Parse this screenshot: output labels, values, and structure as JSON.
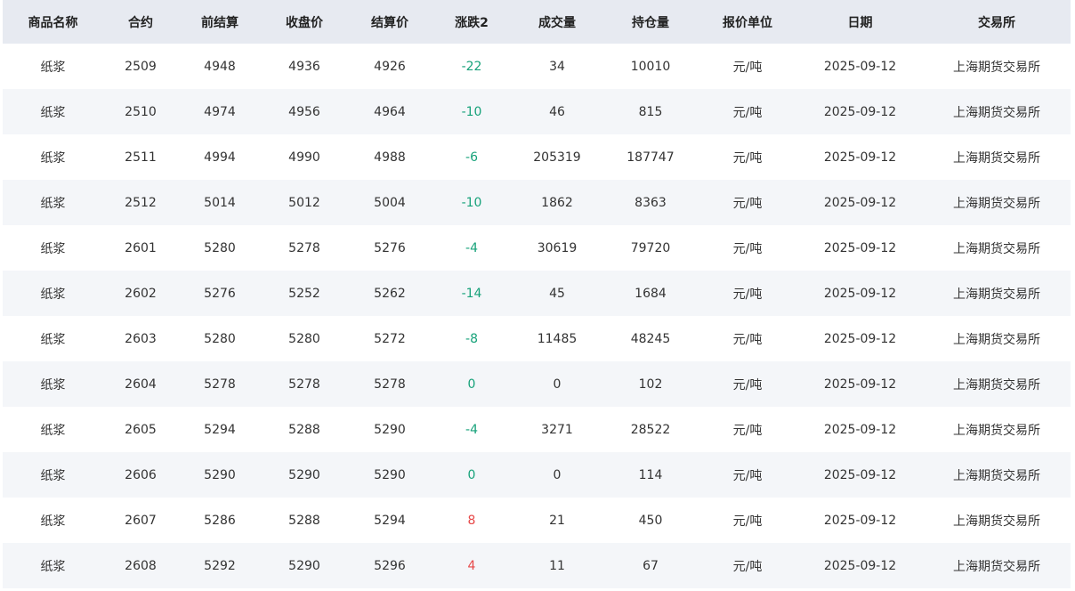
{
  "table": {
    "headers": [
      "商品名称",
      "合约",
      "前结算",
      "收盘价",
      "结算价",
      "涨跌2",
      "成交量",
      "持仓量",
      "报价单位",
      "日期",
      "交易所"
    ],
    "rows": [
      [
        "纸浆",
        "2509",
        "4948",
        "4936",
        "4926",
        "-22",
        "34",
        "10010",
        "元/吨",
        "2025-09-12",
        "上海期货交易所"
      ],
      [
        "纸浆",
        "2510",
        "4974",
        "4956",
        "4964",
        "-10",
        "46",
        "815",
        "元/吨",
        "2025-09-12",
        "上海期货交易所"
      ],
      [
        "纸浆",
        "2511",
        "4994",
        "4990",
        "4988",
        "-6",
        "205319",
        "187747",
        "元/吨",
        "2025-09-12",
        "上海期货交易所"
      ],
      [
        "纸浆",
        "2512",
        "5014",
        "5012",
        "5004",
        "-10",
        "1862",
        "8363",
        "元/吨",
        "2025-09-12",
        "上海期货交易所"
      ],
      [
        "纸浆",
        "2601",
        "5280",
        "5278",
        "5276",
        "-4",
        "30619",
        "79720",
        "元/吨",
        "2025-09-12",
        "上海期货交易所"
      ],
      [
        "纸浆",
        "2602",
        "5276",
        "5252",
        "5262",
        "-14",
        "45",
        "1684",
        "元/吨",
        "2025-09-12",
        "上海期货交易所"
      ],
      [
        "纸浆",
        "2603",
        "5280",
        "5280",
        "5272",
        "-8",
        "11485",
        "48245",
        "元/吨",
        "2025-09-12",
        "上海期货交易所"
      ],
      [
        "纸浆",
        "2604",
        "5278",
        "5278",
        "5278",
        "0",
        "0",
        "102",
        "元/吨",
        "2025-09-12",
        "上海期货交易所"
      ],
      [
        "纸浆",
        "2605",
        "5294",
        "5288",
        "5290",
        "-4",
        "3271",
        "28522",
        "元/吨",
        "2025-09-12",
        "上海期货交易所"
      ],
      [
        "纸浆",
        "2606",
        "5290",
        "5290",
        "5290",
        "0",
        "0",
        "114",
        "元/吨",
        "2025-09-12",
        "上海期货交易所"
      ],
      [
        "纸浆",
        "2607",
        "5286",
        "5288",
        "5294",
        "8",
        "21",
        "450",
        "元/吨",
        "2025-09-12",
        "上海期货交易所"
      ],
      [
        "纸浆",
        "2608",
        "5292",
        "5290",
        "5296",
        "4",
        "11",
        "67",
        "元/吨",
        "2025-09-12",
        "上海期货交易所"
      ]
    ]
  },
  "colors": {
    "header_bg": "#e7eaf1",
    "row_alt_bg": "#f4f6f9",
    "down": "#17a27a",
    "up": "#e74848"
  }
}
